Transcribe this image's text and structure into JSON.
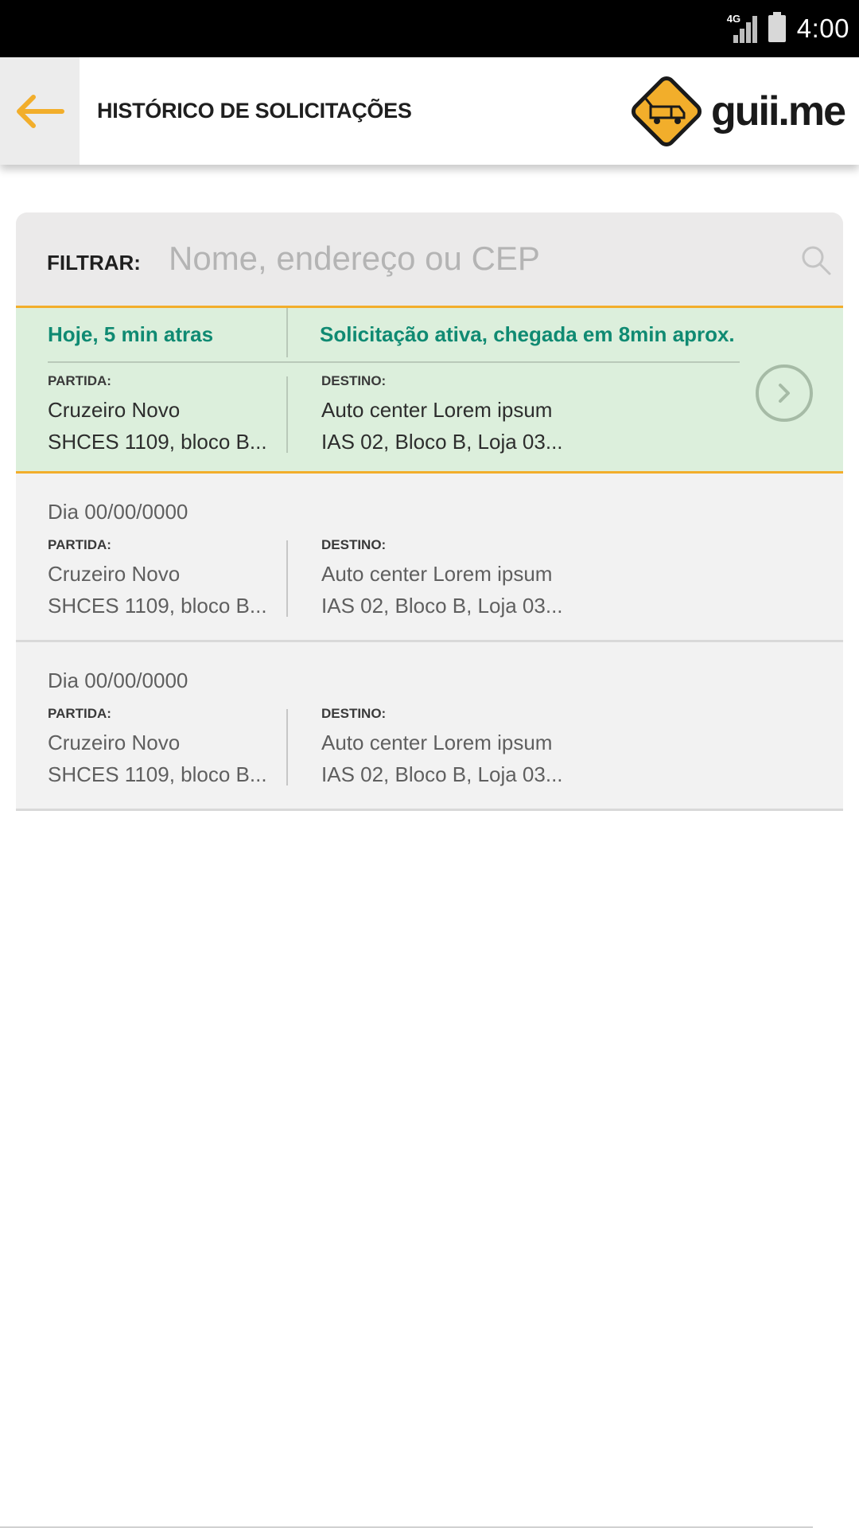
{
  "status_bar": {
    "network": "4G",
    "time": "4:00"
  },
  "header": {
    "title": "HISTÓRICO DE SOLICITAÇÕES",
    "logo_text": "guii.me",
    "accent_color": "#F2AE2B"
  },
  "filter": {
    "label": "FILTRAR:",
    "placeholder": "Nome, endereço ou CEP",
    "value": ""
  },
  "requests": [
    {
      "active": true,
      "when": "Hoje, 5 min atras",
      "status": "Solicitação ativa, chegada em 8min aprox.",
      "origin_label": "PARTIDA:",
      "origin_line1": "Cruzeiro Novo",
      "origin_line2": "SHCES 1109, bloco B...",
      "dest_label": "DESTINO:",
      "dest_line1": "Auto center Lorem ipsum",
      "dest_line2": "IAS 02, Bloco B, Loja 03..."
    },
    {
      "active": false,
      "when": "Dia 00/00/0000",
      "origin_label": "PARTIDA:",
      "origin_line1": "Cruzeiro Novo",
      "origin_line2": "SHCES 1109, bloco B...",
      "dest_label": "DESTINO:",
      "dest_line1": "Auto center Lorem ipsum",
      "dest_line2": "IAS 02, Bloco B, Loja 03..."
    },
    {
      "active": false,
      "when": "Dia 00/00/0000",
      "origin_label": "PARTIDA:",
      "origin_line1": "Cruzeiro Novo",
      "origin_line2": "SHCES 1109, bloco B...",
      "dest_label": "DESTINO:",
      "dest_line1": "Auto center Lorem ipsum",
      "dest_line2": "IAS 02, Bloco B, Loja 03..."
    }
  ],
  "icons": {
    "back": "arrow-left-icon",
    "logo": "tow-truck-icon",
    "search": "search-icon",
    "open": "chevron-right-icon"
  },
  "colors": {
    "active_bg": "#DCEFDC",
    "active_text": "#0F8A72",
    "accent": "#F2AE2B"
  }
}
